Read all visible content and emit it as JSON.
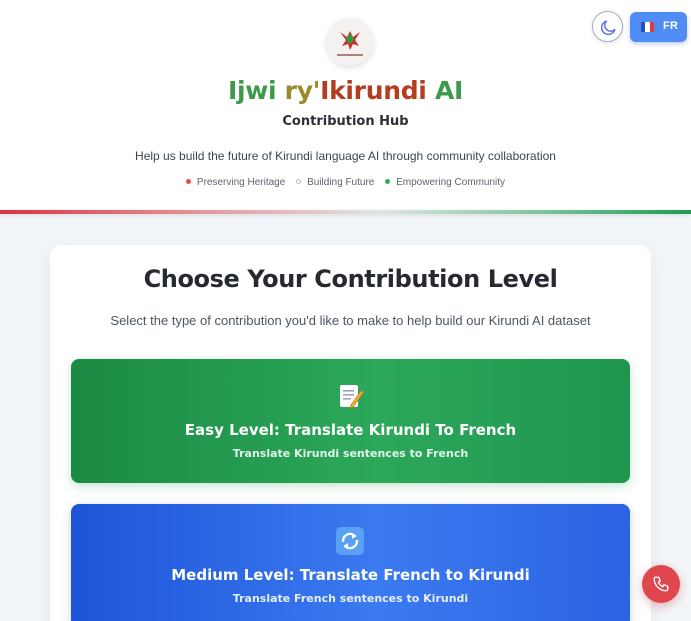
{
  "header": {
    "title_parts": [
      "Ijwi",
      " ry'",
      "Ikirundi",
      " AI"
    ],
    "subtitle": "Contribution Hub",
    "tagline": "Help us build the future of Kirundi language AI through community collaboration",
    "pills": [
      {
        "label": "Preserving Heritage",
        "dot_color": "#e04b4b"
      },
      {
        "label": "Building Future",
        "dot_color": "hollow"
      },
      {
        "label": "Empowering Community",
        "dot_color": "#2eb05d"
      }
    ],
    "logo_text": "Ijwi ry'Ikirundi AI"
  },
  "toolbar": {
    "theme_icon": "moon-icon",
    "language_label": "FR",
    "language_flag": "french-flag-icon"
  },
  "main": {
    "title": "Choose Your Contribution Level",
    "subtitle": "Select the type of contribution you'd like to make to help build our Kirundi AI dataset",
    "levels": [
      {
        "icon": "memo-icon",
        "title": "Easy Level: Translate Kirundi To French",
        "description": "Translate Kirundi sentences to French",
        "color": "#22a055"
      },
      {
        "icon": "cycle-arrows-icon",
        "title": "Medium Level: Translate French to Kirundi",
        "description": "Translate French sentences to Kirundi",
        "color": "#2f6ae8"
      }
    ]
  },
  "floating": {
    "contact_icon": "phone-icon"
  },
  "colors": {
    "accent_red": "#e0464d",
    "accent_green": "#2ca85a",
    "accent_blue": "#4f8df5"
  }
}
